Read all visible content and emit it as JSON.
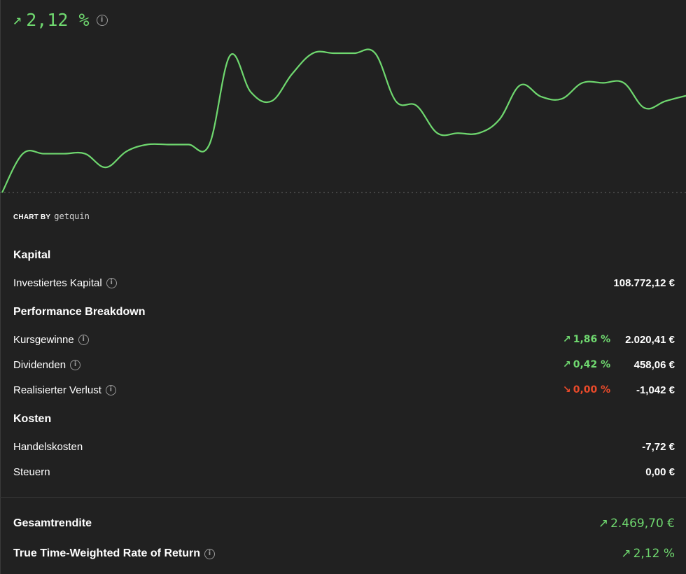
{
  "headline": {
    "value": "2,12 %",
    "arrow": "↗"
  },
  "chart_data": {
    "type": "line",
    "series": [
      {
        "values": [
          0.0,
          0.85,
          0.85,
          0.85,
          0.85,
          0.55,
          0.9,
          1.05,
          1.05,
          1.05,
          1.05,
          3.0,
          2.2,
          2.0,
          2.6,
          3.05,
          3.05,
          3.05,
          3.05,
          2.0,
          1.9,
          1.3,
          1.3,
          1.3,
          1.6,
          2.35,
          2.1,
          2.05,
          2.4,
          2.4,
          2.4,
          1.85,
          2.0,
          2.12
        ]
      }
    ],
    "baseline": 0,
    "color": "#6fd86f",
    "grid": false
  },
  "chartby": {
    "label": "CHART BY",
    "brand": "getquin"
  },
  "kapital": {
    "title": "Kapital",
    "investiert_label": "Investiertes Kapital",
    "investiert_value": "108.772,12  €"
  },
  "breakdown": {
    "title": "Performance Breakdown",
    "rows": [
      {
        "label": "Kursgewinne",
        "arrow": "↗",
        "pct": "1,86  %",
        "value": "2.020,41  €"
      },
      {
        "label": "Dividenden",
        "arrow": "↗",
        "pct": "0,42  %",
        "value": "458,06  €"
      },
      {
        "label": "Realisierter Verlust",
        "arrow": "↘",
        "pct": "0,00  %",
        "value": "-1,042  €"
      }
    ]
  },
  "kosten": {
    "title": "Kosten",
    "rows": [
      {
        "label": "Handelskosten",
        "value": "-7,72  €"
      },
      {
        "label": "Steuern",
        "value": "0,00  €"
      }
    ]
  },
  "summary": {
    "gesamt_label": "Gesamtrendite",
    "gesamt_arrow": "↗",
    "gesamt_value": "2.469,70  €",
    "ttwror_label": "True Time-Weighted Rate of Return",
    "ttwror_arrow": "↗",
    "ttwror_value": "2,12  %"
  },
  "colors": {
    "positive": "#6fd86f",
    "negative": "#ea4a2a",
    "background": "#212121"
  },
  "icons": {
    "info": "info-icon",
    "up": "arrow-up-right-icon",
    "down": "arrow-down-right-icon"
  }
}
